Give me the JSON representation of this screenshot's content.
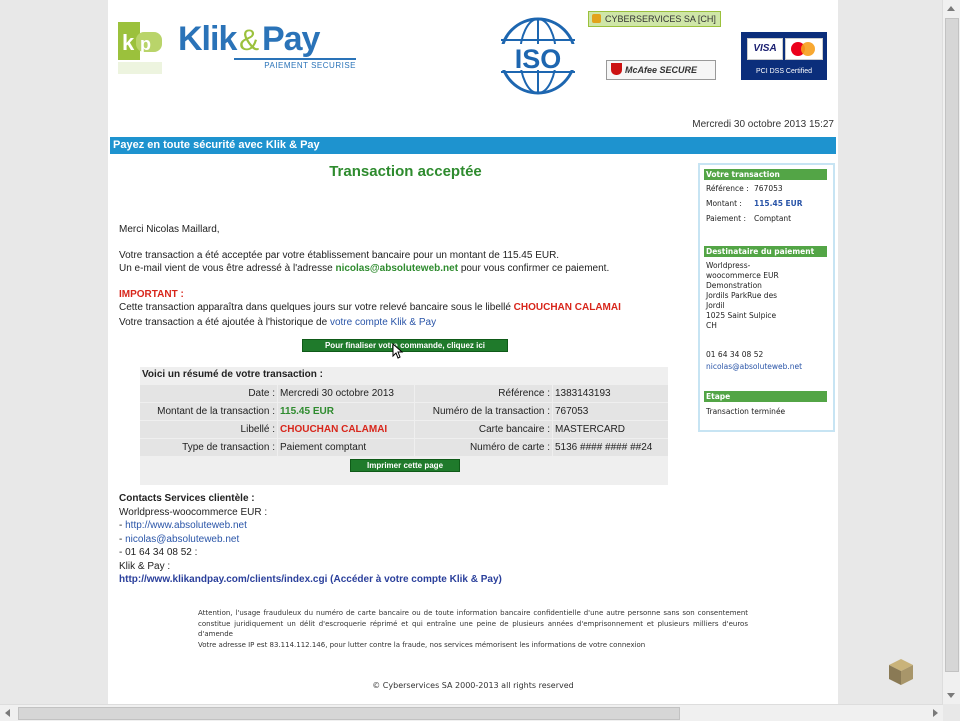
{
  "header": {
    "logo": {
      "klik": "Klik",
      "amp": "&",
      "pay": "Pay",
      "subtitle": "PAIEMENT SECURISE"
    },
    "ssl_badge": "CYBERSERVICES SA [CH]",
    "mcafee": "McAfee SECURE",
    "pci": {
      "visa": "VISA",
      "caption": "PCI DSS Certified"
    },
    "iso": "ISO",
    "date": "Mercredi 30 octobre 2013 15:27"
  },
  "bar": {
    "text": "Payez en toute sécurité avec Klik & Pay"
  },
  "main": {
    "title": "Transaction acceptée",
    "greeting": "Merci Nicolas Maillard,",
    "line1": "Votre transaction a été acceptée par votre établissement bancaire pour un montant de 115.45 EUR.",
    "line2_pre": "Un e-mail vient de vous être adressé à l'adresse",
    "line2_email": "nicolas@absoluteweb.net",
    "line2_post": "pour vous confirmer ce paiement.",
    "important_label": "IMPORTANT :",
    "important1_pre": "Cette transaction apparaîtra dans quelques jours sur votre relevé bancaire sous le libellé",
    "important1_label": "CHOUCHAN CALAMAI",
    "important2_pre": "Votre transaction a été ajoutée à l'historique de",
    "important2_link": "votre compte Klik & Pay",
    "finalize_button": "Pour finaliser votre commande, cliquez ici"
  },
  "summary": {
    "heading": "Voici un résumé de votre transaction :",
    "rows": [
      {
        "l1": "Date :",
        "v1": "Mercredi 30 octobre 2013",
        "l2": "Référence :",
        "v2": "1383143193"
      },
      {
        "l1": "Montant de la transaction :",
        "v1": "115.45 EUR",
        "l2": "Numéro de la transaction :",
        "v2": "767053"
      },
      {
        "l1": "Libellé :",
        "v1": "CHOUCHAN CALAMAI",
        "l2": "Carte bancaire :",
        "v2": "MASTERCARD"
      },
      {
        "l1": "Type de transaction :",
        "v1": "Paiement comptant",
        "l2": "Numéro de carte :",
        "v2": "5136 #### #### ##24"
      }
    ],
    "print_button": "Imprimer cette page"
  },
  "contacts": {
    "heading": "Contacts Services clientèle :",
    "merchant": "Worldpress-woocommerce EUR :",
    "site": "http://www.absoluteweb.net",
    "email": "nicolas@absoluteweb.net",
    "phone": "- 01 64 34 08 52 :",
    "klikpay": "Klik & Pay :",
    "account_url": "http://www.klikandpay.com/clients/index.cgi",
    "account_text": "(Accéder à votre compte Klik & Pay)"
  },
  "footer": {
    "note": "Attention, l'usage frauduleux du numéro de carte bancaire ou de toute information bancaire confidentielle d'une autre personne sans son consentement constitue juridiquement un délit d'escroquerie réprimé et qui entraîne une peine de plusieurs années d'emprisonnement et plusieurs milliers d'euros d'amende",
    "ip_note": "Votre adresse IP est 83.114.112.146, pour lutter contre la fraude, nos services mémorisent les informations de votre connexion",
    "copyright": "© Cyberservices SA 2000-2013 all rights reserved"
  },
  "sidebar": {
    "transaction_title": "Votre transaction",
    "ref_label": "Référence :",
    "ref_value": "767053",
    "amount_label": "Montant :",
    "amount_value": "115.45 EUR",
    "payment_label": "Paiement :",
    "payment_value": "Comptant",
    "recipient_title": "Destinataire du paiement",
    "recipient_lines": [
      "Worldpress-",
      "woocommerce EUR",
      "Demonstration",
      "Jordils    ParkRue    des",
      "Jordil",
      "1025 Saint Sulpice",
      "CH"
    ],
    "phone": "01 64 34 08 52",
    "email": "nicolas@absoluteweb.net",
    "step_title": "Etape",
    "step_value": "Transaction terminée"
  },
  "colors": {
    "accent_blue": "#1e93cf",
    "green": "#2e8b2e",
    "red": "#d8261b",
    "button_green": "#1f7a2b",
    "sidebar_green": "#53a546"
  }
}
